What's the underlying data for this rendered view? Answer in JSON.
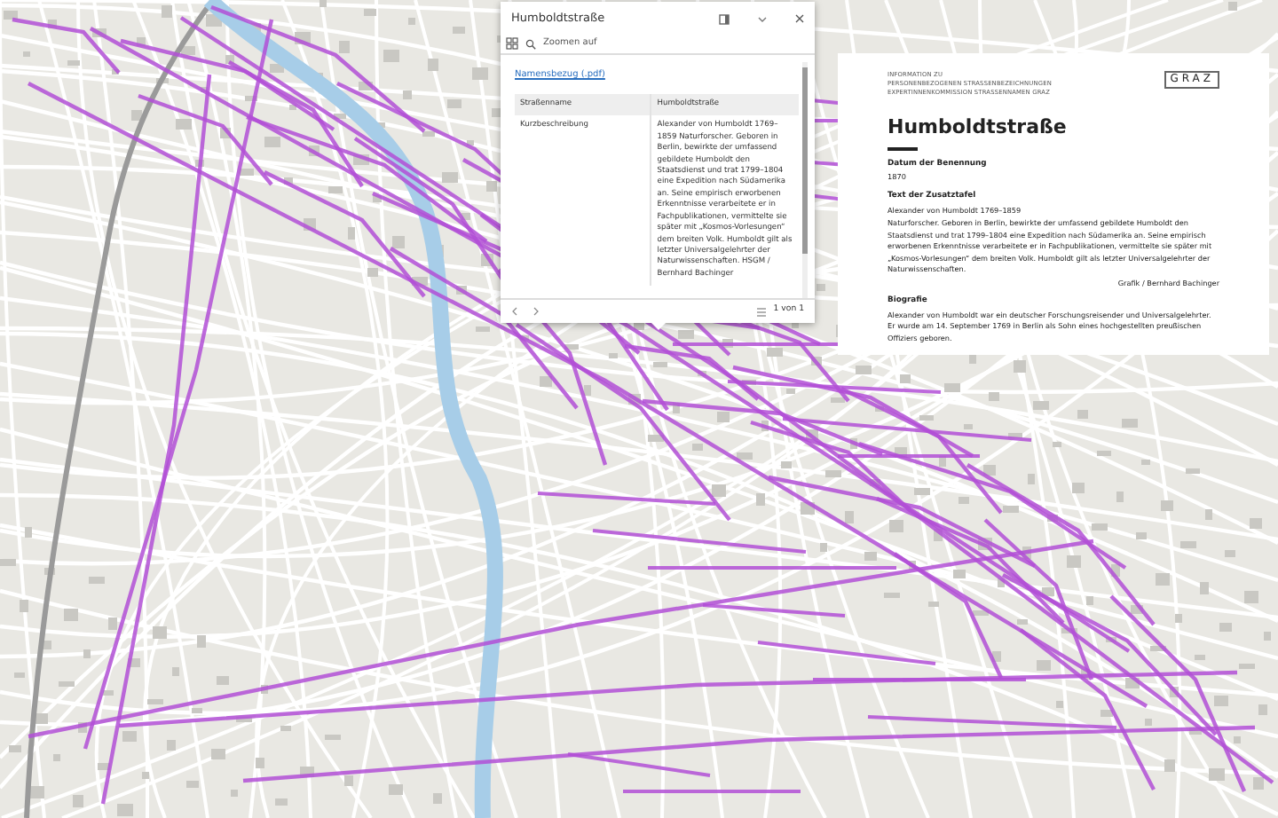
{
  "popup": {
    "title": "Humboldtstraße",
    "zoom_label": "Zoomen auf",
    "link": "Namensbezug (.pdf)",
    "table": {
      "columns": [
        "Straßenname",
        "Humboldtstraße"
      ],
      "rows": [
        [
          "Kurzbeschreibung",
          "Alexander von Humboldt 1769–1859 Naturforscher. Geboren in Berlin, bewirkte der umfassend gebildete Humboldt den Staatsdienst und trat 1799–1804 eine Expedition nach Südamerika an. Seine empirisch erworbenen Erkenntnisse verarbeitete er in Fachpublikationen, vermittelte sie später mit „Kosmos-Vorlesungen“ dem breiten Volk. Humboldt gilt als letzter Universalgelehrter der Naturwissenschaften. HSGM / Bernhard Bachinger"
        ]
      ]
    },
    "pager": "1 von 1"
  },
  "document": {
    "header_lines": [
      "INFORMATION ZU",
      "PERSONENBEZOGENEN STRASSENBEZEICHNUNGEN",
      "EXPERTINNENKOMMISSION STRASSENNAMEN GRAZ"
    ],
    "logo": "GRAZ",
    "title": "Humboldtstraße",
    "sections": [
      {
        "kind": "field",
        "heading": "Datum der Benennung",
        "lines": [
          "1870"
        ]
      },
      {
        "kind": "field",
        "heading": "Text der Zusatztafel",
        "lines": [
          "Alexander von Humboldt 1769–1859",
          "Naturforscher. Geboren in Berlin, bewirkte der umfassend gebildete Humboldt den Staatsdienst und trat 1799–1804 eine Expedition nach Südamerika an. Seine empirisch erworbenen Erkenntnisse verarbeitete er in Fachpublikationen, vermittelte sie später mit „Kosmos-Vorlesungen“ dem breiten Volk. Humboldt gilt als letzter Universalgelehrter der Naturwissenschaften."
        ],
        "credit": "Grafik / Bernhard Bachinger"
      },
      {
        "kind": "field",
        "heading": "Biografie",
        "lines": [
          "Alexander von Humboldt war ein deutscher Forschungsreisender und Universalgelehrter. Er wurde am 14. September 1769 in Berlin als Sohn eines hochgestellten preußischen Offiziers geboren."
        ]
      }
    ]
  }
}
